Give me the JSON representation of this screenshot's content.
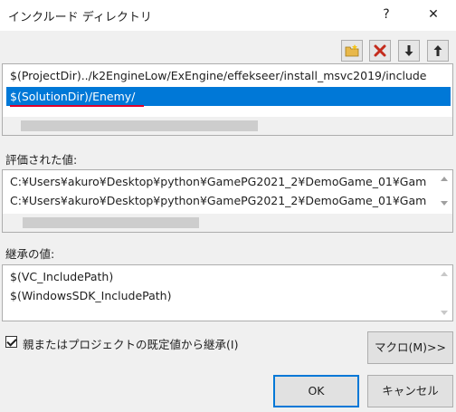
{
  "window": {
    "title": "インクルード ディレクトリ",
    "help_label": "?",
    "close_label": "✕"
  },
  "toolbar": {
    "icons": [
      "new-folder-icon",
      "delete-icon",
      "move-down-icon",
      "move-up-icon"
    ]
  },
  "editor": {
    "lines": [
      "$(ProjectDir)../k2EngineLow/ExEngine/effekseer/install_msvc2019/include",
      "$(SolutionDir)/Enemy/"
    ],
    "selected_index": 1
  },
  "evaluated": {
    "label": "評価された値:",
    "lines": [
      "C:¥Users¥akuro¥Desktop¥python¥GamePG2021_2¥DemoGame_01¥Gam",
      "C:¥Users¥akuro¥Desktop¥python¥GamePG2021_2¥DemoGame_01¥Gam"
    ]
  },
  "inherited": {
    "label": "継承の値:",
    "lines": [
      "$(VC_IncludePath)",
      "$(WindowsSDK_IncludePath)"
    ]
  },
  "inherit_checkbox": {
    "label": "親またはプロジェクトの既定値から継承(I)",
    "checked": true
  },
  "buttons": {
    "macro": "マクロ(M)>>",
    "ok": "OK",
    "cancel": "キャンセル"
  },
  "colors": {
    "selection": "#0078d7",
    "annotation_underline": "#e0002b",
    "delete_icon": "#c42b1c"
  }
}
